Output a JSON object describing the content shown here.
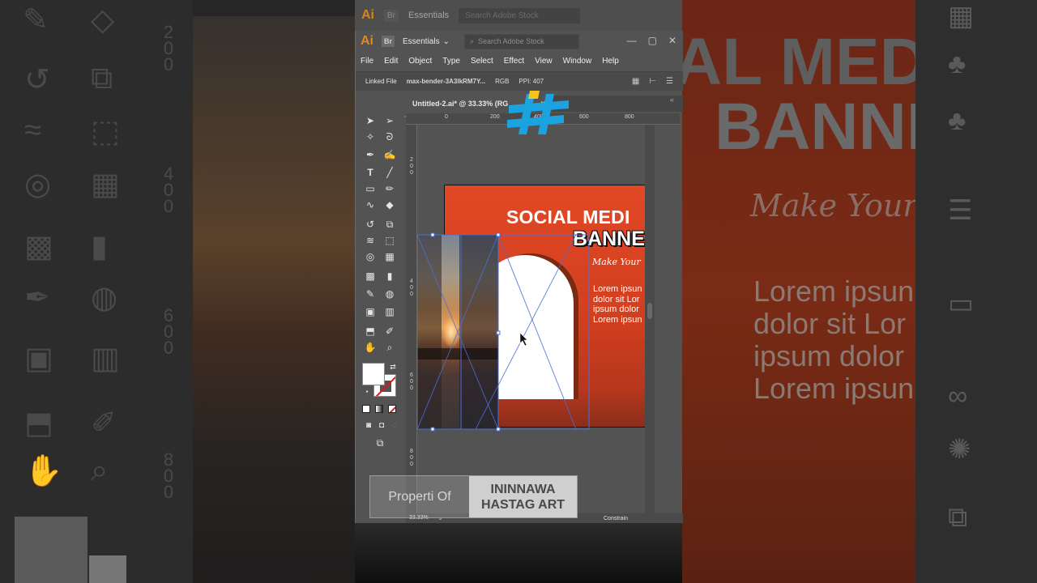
{
  "app": {
    "logo": "Ai",
    "bridge": "Br",
    "workspace": "Essentials",
    "search_placeholder": "Search Adobe Stock",
    "win_controls": [
      "—",
      "▢",
      "✕"
    ]
  },
  "menu": [
    "File",
    "Edit",
    "Object",
    "Type",
    "Select",
    "Effect",
    "View",
    "Window",
    "Help"
  ],
  "control_bar": {
    "linked": "Linked File",
    "filename": "max-bender-3A3lkRM7Y...",
    "mode": "RGB",
    "ppi": "PPI: 407"
  },
  "document_tab": {
    "title": "Untitled-2.ai* @ 33.33% (RG",
    "close": "×"
  },
  "ruler": {
    "h_labels": [
      "0",
      "200",
      "400",
      "600",
      "800"
    ],
    "v_labels": [
      "2\n0\n0",
      "4\n0\n0",
      "6\n0\n0",
      "8\n0\n0"
    ]
  },
  "artboard": {
    "title_line1": "SOCIAL MEDI",
    "title_line2": "BANNE",
    "script": "Make Your",
    "lorem": [
      "Lorem ipsun",
      "dolor sit Lor",
      "ipsum dolor",
      "Lorem ipsun"
    ]
  },
  "status": {
    "zoom": "33.33%",
    "constrain": "Constrain"
  },
  "watermark": {
    "left": "Properti Of",
    "right_line1": "ININNAWA",
    "right_line2": "HASTAG ART"
  },
  "background": {
    "big_line1": "AL MEDI",
    "big_line2": "BANNE",
    "script": "Make Your",
    "lorem": [
      "Lorem ipsun",
      "dolor sit Lor",
      "ipsum dolor",
      "Lorem ipsun"
    ]
  },
  "colors": {
    "accent_orange": "#e14825",
    "logo_blue": "#1aa3e0",
    "logo_yellow": "#f6c21c",
    "ui_gray": "#535353"
  },
  "icons": {
    "selection": "selection-tool-icon",
    "direct_selection": "direct-selection-tool-icon",
    "magic_wand": "magic-wand-tool-icon",
    "lasso": "lasso-tool-icon",
    "pen": "pen-tool-icon",
    "type": "type-tool-icon",
    "hand": "hand-tool-icon",
    "zoom": "zoom-tool-icon"
  }
}
